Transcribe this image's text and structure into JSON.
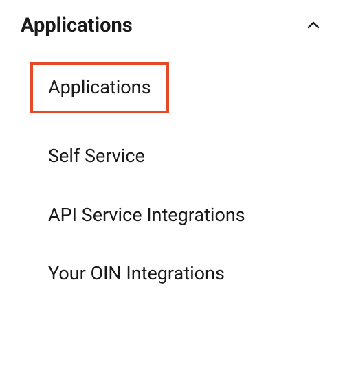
{
  "nav": {
    "section_title": "Applications",
    "expanded": true,
    "highlight_color": "#e34a26",
    "items": [
      {
        "label": "Applications",
        "highlighted": true
      },
      {
        "label": "Self Service",
        "highlighted": false
      },
      {
        "label": "API Service Integrations",
        "highlighted": false
      },
      {
        "label": "Your OIN Integrations",
        "highlighted": false
      }
    ]
  }
}
